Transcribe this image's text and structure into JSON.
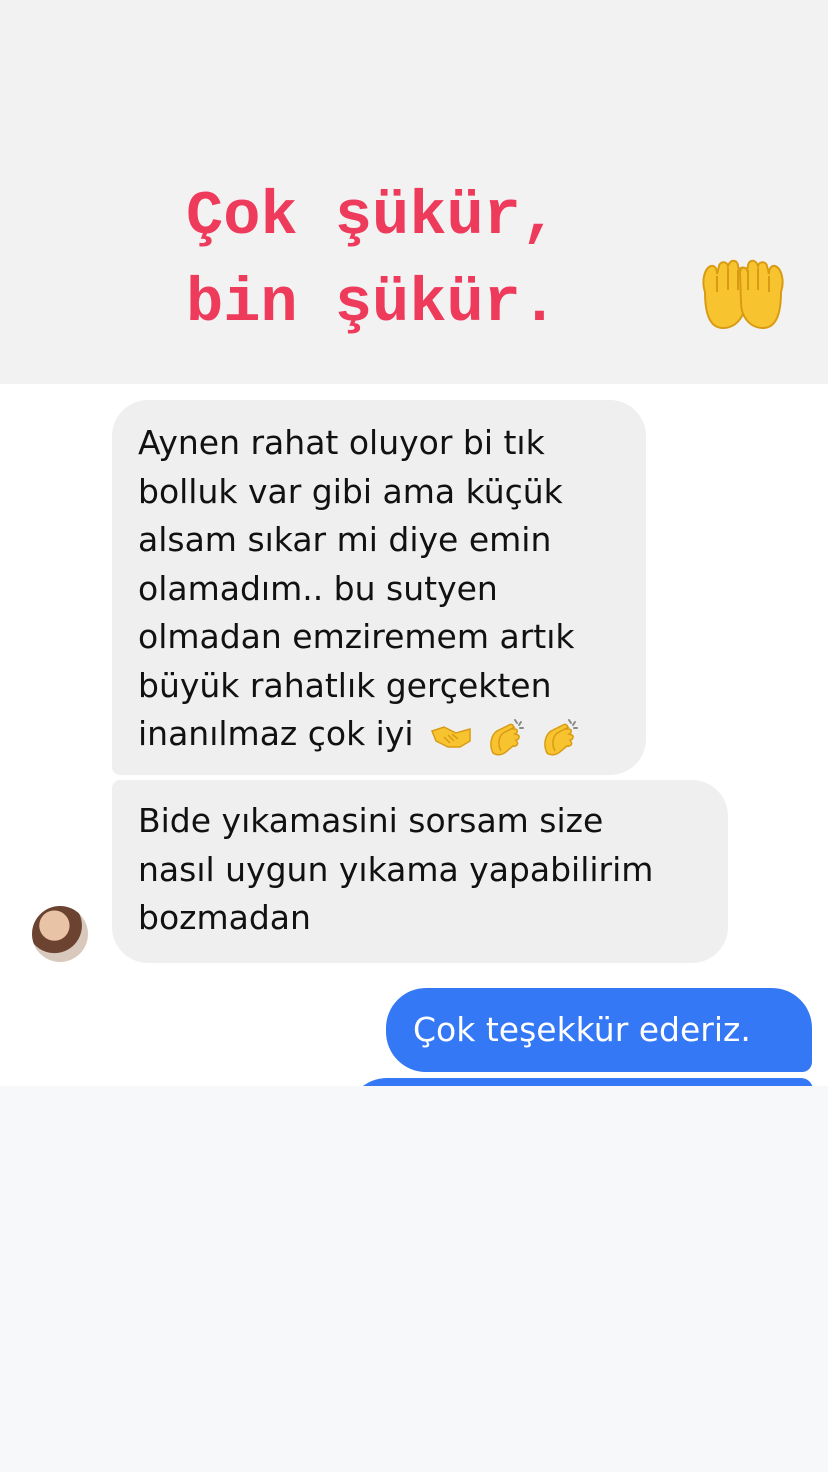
{
  "story_caption": {
    "line1": "Çok şükür,",
    "line2": "bin şükür.",
    "emoji": "palms-up-together-icon",
    "color": "#ee3b5b"
  },
  "conversation": {
    "incoming": [
      {
        "lines": [
          "Aynen rahat oluyor bi tık",
          "bolluk var gibi ama küçük",
          "alsam sıkar mi diye emin",
          "olamadım.. bu sutyen",
          "olmadan emziremem artık",
          "büyük rahatlık gerçekten",
          "inanılmaz çok iyi"
        ],
        "emojis": [
          "handshake-icon",
          "clapping-hands-icon",
          "clapping-hands-icon"
        ]
      },
      {
        "lines": [
          "Bide yıkamasini sorsam size",
          "nasıl uygun yıkama yapabilirim",
          "bozmadan"
        ]
      }
    ],
    "outgoing": [
      {
        "text": "Çok teşekkür ederiz."
      }
    ],
    "colors": {
      "incoming_bubble": "#efefef",
      "outgoing_bubble": "#3478f6"
    }
  }
}
